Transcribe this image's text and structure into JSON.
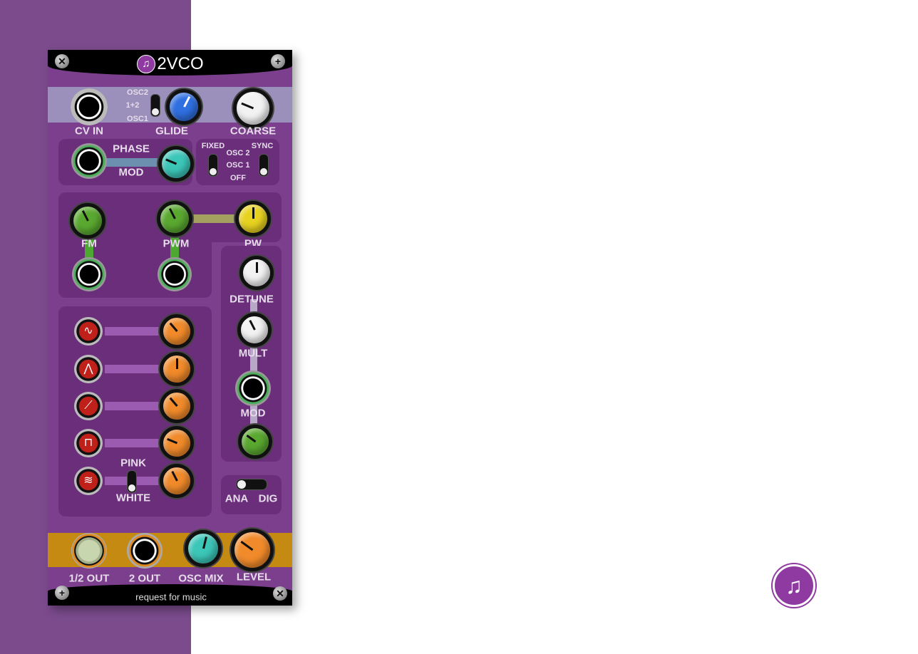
{
  "module": {
    "title": "2VCO",
    "brand": "request for music",
    "logo_icon": "music-note-icon"
  },
  "colors": {
    "panel": "#7c3f8d",
    "side": "#7b4b8c",
    "top_band": "#9b8fbb",
    "out_band": "#c58a12",
    "knob_blue": "#2f6fe0",
    "knob_teal": "#3cc6b8",
    "knob_green": "#5aa830",
    "knob_yellow": "#e8d220",
    "knob_orange": "#f08a2a",
    "knob_white": "#f2f2f2",
    "logo": "#8e3aa0"
  },
  "top": {
    "cv_in": "CV IN",
    "glide": "GLIDE",
    "coarse": "COARSE",
    "switch_opts": [
      "OSC2",
      "1+2",
      "OSC1"
    ]
  },
  "phase": {
    "phase": "PHASE",
    "mod": "MOD",
    "fixed": "FIXED",
    "sync": "SYNC",
    "opts": [
      "OSC 2",
      "OSC 1",
      "OFF"
    ]
  },
  "mod": {
    "fm": "FM",
    "pwm": "PWM",
    "pw": "PW",
    "detune": "DETUNE",
    "mult": "MULT",
    "mod": "MOD"
  },
  "noise": {
    "pink": "PINK",
    "white": "WHITE"
  },
  "mode": {
    "ana": "ANA",
    "dig": "DIG"
  },
  "outputs": {
    "half_out": "1/2 OUT",
    "two_out": "2 OUT",
    "osc_mix": "OSC MIX",
    "level": "LEVEL"
  },
  "waves": [
    "sine",
    "triangle",
    "saw",
    "square",
    "noise"
  ],
  "knob_values": {
    "glide": 0.6,
    "coarse": 0.25,
    "phase_mod": 0.25,
    "fm": 0.4,
    "pwm": 0.4,
    "pw": 0.5,
    "detune": 0.5,
    "mult": 0.4,
    "mod_amt": 0.3,
    "wave1": 0.35,
    "wave2": 0.5,
    "wave3": 0.35,
    "wave4": 0.25,
    "wave5": 0.4,
    "osc_mix": 0.55,
    "level": 0.3
  }
}
